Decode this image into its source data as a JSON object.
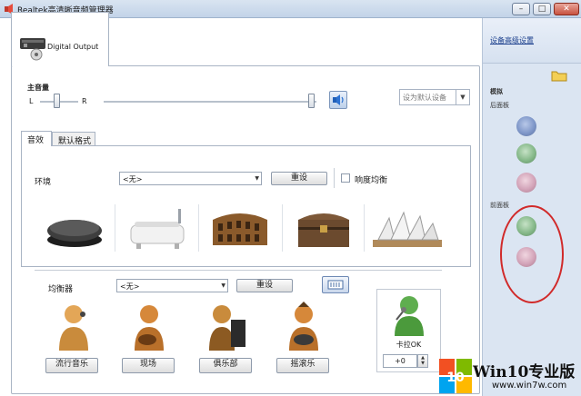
{
  "window": {
    "title": "Realtek高清晰音频管理器",
    "controls": [
      "–",
      "□",
      "✕"
    ]
  },
  "device_tab": {
    "label": "Digital Output"
  },
  "volume": {
    "label": "主音量",
    "left_label": "L",
    "right_label": "R",
    "set_default": "设为默认设备"
  },
  "tabs": [
    "音效",
    "默认格式"
  ],
  "environment": {
    "label": "环境",
    "selected": "<无>",
    "reset_label": "重设",
    "loudness_label": "响度均衡",
    "presets": [
      "stone",
      "bathtub",
      "colosseum",
      "chest",
      "opera-house"
    ]
  },
  "equalizer": {
    "label": "均衡器",
    "selected": "<无>",
    "reset_label": "重设",
    "genres": [
      "流行音乐",
      "现场",
      "俱乐部",
      "摇滚乐"
    ]
  },
  "karaoke": {
    "label": "卡拉OK",
    "value": "+0"
  },
  "right_panel": {
    "advanced_link": "设备高级设置",
    "analog_label": "模拟",
    "back_panel_label": "后面板",
    "front_panel_label": "前面板",
    "back_jacks": [
      "#7f97c9",
      "#86b98a",
      "#d3a4b9"
    ],
    "front_jacks": [
      "#86b98a",
      "#d3a4b9"
    ],
    "highlight_color": "#d12a2a"
  },
  "watermark": {
    "title": "Win10专业版",
    "url": "www.win7w.com"
  }
}
